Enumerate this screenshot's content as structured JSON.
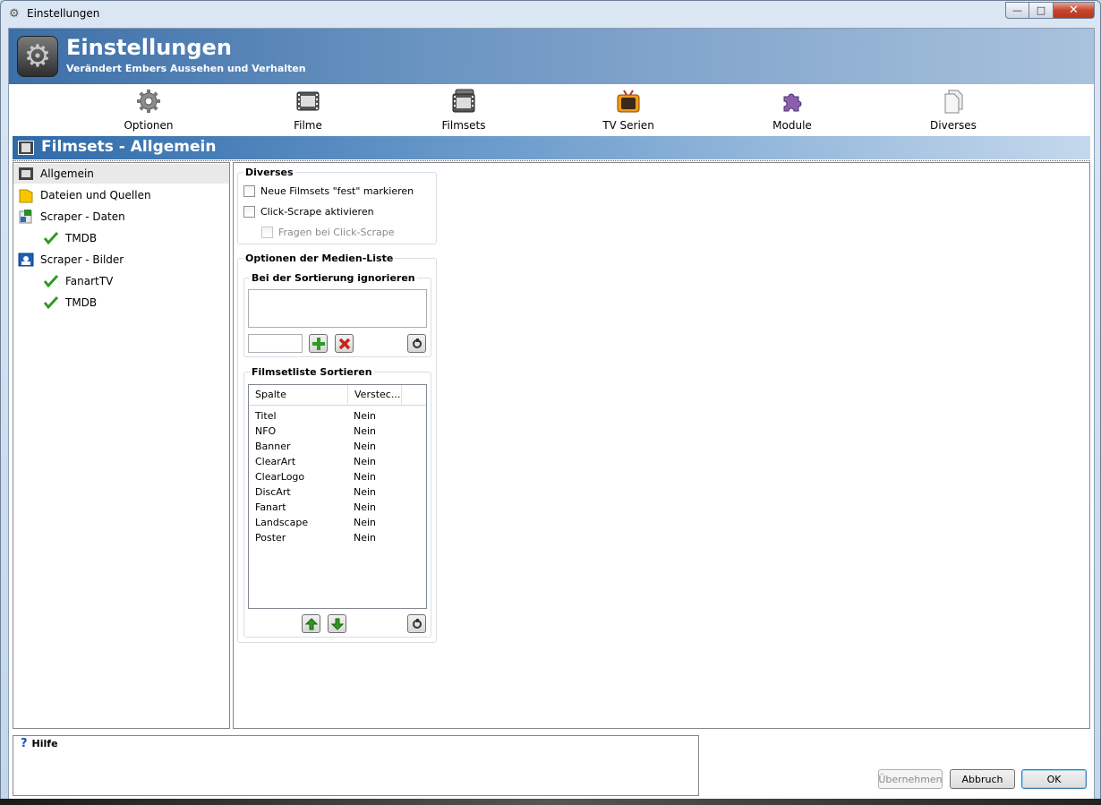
{
  "window": {
    "title": "Einstellungen",
    "controls": {
      "minimize": "—",
      "maximize": "□",
      "close": "✕"
    }
  },
  "banner": {
    "title": "Einstellungen",
    "subtitle": "Verändert Embers Aussehen und Verhalten"
  },
  "toolbar": {
    "items": [
      {
        "label": "Optionen",
        "icon": "gear-icon"
      },
      {
        "label": "Filme",
        "icon": "film-icon"
      },
      {
        "label": "Filmsets",
        "icon": "filmsets-icon"
      },
      {
        "label": "TV Serien",
        "icon": "tv-icon"
      },
      {
        "label": "Module",
        "icon": "puzzle-icon"
      },
      {
        "label": "Diverses",
        "icon": "documents-icon"
      }
    ]
  },
  "section": {
    "title": "Filmsets - Allgemein"
  },
  "tree": {
    "items": [
      {
        "label": "Allgemein",
        "icon": "film-icon",
        "selected": true
      },
      {
        "label": "Dateien und Quellen",
        "icon": "folder-icon"
      },
      {
        "label": "Scraper - Daten",
        "icon": "scraper-data-icon"
      },
      {
        "label": "TMDB",
        "icon": "check-icon"
      },
      {
        "label": "Scraper - Bilder",
        "icon": "scraper-images-icon"
      },
      {
        "label": "FanartTV",
        "icon": "check-icon"
      },
      {
        "label": "TMDB",
        "icon": "check-icon"
      }
    ]
  },
  "diverses": {
    "title": "Diverses",
    "options": [
      {
        "label": "Neue Filmsets \"fest\" markieren",
        "checked": false
      },
      {
        "label": "Click-Scrape aktivieren",
        "checked": false
      },
      {
        "label": "Fragen bei Click-Scrape",
        "checked": false,
        "disabled": true
      }
    ]
  },
  "medialist": {
    "title": "Optionen der Medien-Liste",
    "ignore": {
      "title": "Bei der Sortierung ignorieren",
      "input_value": ""
    },
    "sort": {
      "title": "Filmsetliste Sortieren",
      "columns": [
        "Spalte",
        "Versteс..."
      ],
      "rows": [
        {
          "col": "Titel",
          "hidden": "Nein"
        },
        {
          "col": "NFO",
          "hidden": "Nein"
        },
        {
          "col": "Banner",
          "hidden": "Nein"
        },
        {
          "col": "ClearArt",
          "hidden": "Nein"
        },
        {
          "col": "ClearLogo",
          "hidden": "Nein"
        },
        {
          "col": "DiscArt",
          "hidden": "Nein"
        },
        {
          "col": "Fanart",
          "hidden": "Nein"
        },
        {
          "col": "Landscape",
          "hidden": "Nein"
        },
        {
          "col": "Poster",
          "hidden": "Nein"
        }
      ]
    }
  },
  "help": {
    "title": "Hilfe"
  },
  "buttons": {
    "apply": "Übernehmen",
    "cancel": "Abbruch",
    "ok": "OK"
  },
  "colors": {
    "banner_start": "#3c6fa8",
    "section_start": "#2f6aa8",
    "check_green": "#2e9b1f"
  }
}
